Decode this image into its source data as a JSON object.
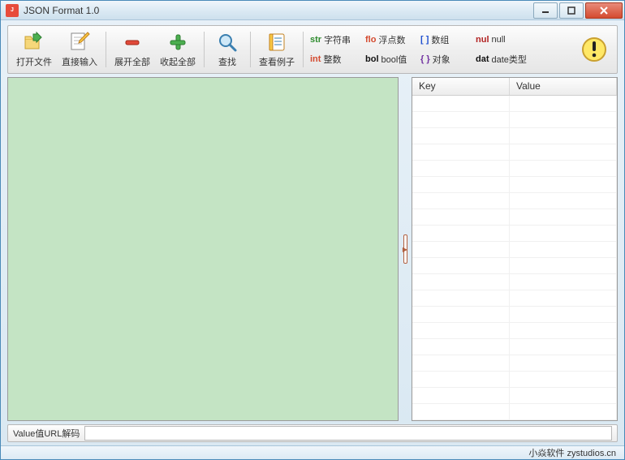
{
  "window": {
    "title": "JSON Format 1.0"
  },
  "toolbar": {
    "open_file": "打开文件",
    "direct_input": "直接输入",
    "expand_all": "展开全部",
    "collapse_all": "收起全部",
    "find": "查找",
    "view_example": "查看例子"
  },
  "legend": {
    "str": {
      "tag": "str",
      "label": "字符串",
      "color": "#2e8b2e"
    },
    "flo": {
      "tag": "flo",
      "label": "浮点数",
      "color": "#d44a2f"
    },
    "arr": {
      "tag": "[ ]",
      "label": "数组",
      "color": "#2050d0"
    },
    "nul": {
      "tag": "nul",
      "label": "null",
      "color": "#b22222"
    },
    "int": {
      "tag": "int",
      "label": "整数",
      "color": "#d44a2f"
    },
    "bol": {
      "tag": "bol",
      "label": "bool值",
      "color": "#111"
    },
    "obj": {
      "tag": "{ }",
      "label": "对象",
      "color": "#7030a0"
    },
    "dat": {
      "tag": "dat",
      "label": "date类型",
      "color": "#111"
    }
  },
  "grid": {
    "key_header": "Key",
    "value_header": "Value"
  },
  "bottom": {
    "label": "Value值URL解码",
    "value": ""
  },
  "status": {
    "text": "小焱软件 zystudios.cn"
  },
  "colors": {
    "canvas_bg": "#c4e4c4"
  }
}
